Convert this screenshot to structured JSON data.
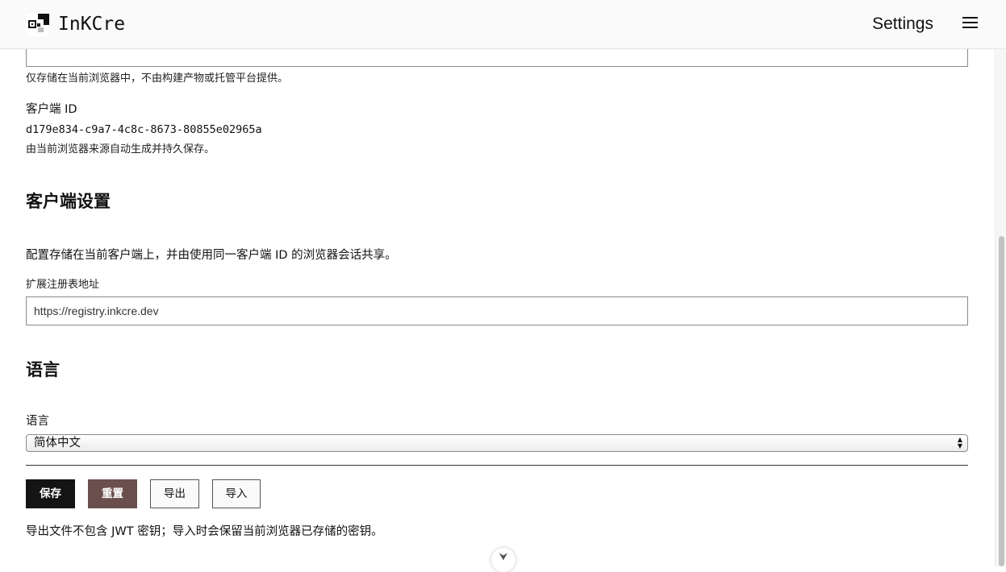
{
  "app": {
    "brand": "InKCre",
    "nav_settings": "Settings"
  },
  "jwt": {
    "masked_value": "········",
    "hint": "仅存储在当前浏览器中，不由构建产物或托管平台提供。"
  },
  "client_id": {
    "label": "客户端 ID",
    "value": "d179e834-c9a7-4c8c-8673-80855e02965a",
    "hint": "由当前浏览器来源自动生成并持久保存。"
  },
  "client_settings": {
    "heading": "客户端设置",
    "description": "配置存储在当前客户端上，并由使用同一客户端 ID 的浏览器会话共享。",
    "registry_label": "扩展注册表地址",
    "registry_value": "https://registry.inkcre.dev"
  },
  "language": {
    "heading": "语言",
    "label": "语言",
    "selected": "简体中文"
  },
  "actions": {
    "save": "保存",
    "reset": "重置",
    "export": "导出",
    "import": "导入",
    "note": "导出文件不包含 JWT 密钥；导入时会保留当前浏览器已存储的密钥。"
  },
  "colors": {
    "reset_button": "#6b4f4c",
    "save_button": "#141414"
  }
}
